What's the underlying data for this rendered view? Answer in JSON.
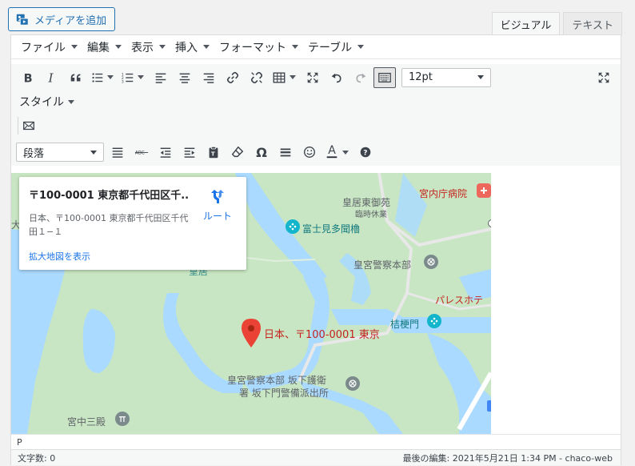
{
  "top": {
    "media_button": "メディアを追加",
    "tabs": [
      {
        "label": "ビジュアル",
        "active": true
      },
      {
        "label": "テキスト",
        "active": false
      }
    ]
  },
  "menubar": [
    "ファイル",
    "編集",
    "表示",
    "挿入",
    "フォーマット",
    "テーブル"
  ],
  "toolbar": {
    "font_size": "12pt",
    "style_label": "スタイル",
    "format_select": "段落",
    "text_color_letter": "A",
    "omega": "Ω"
  },
  "map": {
    "info": {
      "title": "〒100-0001 東京都千代田区千...",
      "address": "日本、〒100-0001 東京都千代田区千代田１−１",
      "route_label": "ルート",
      "larger_map_link": "拡大地図を表示"
    },
    "labels": {
      "koukyo_higashi": "皇居東御苑",
      "rinji_kyugyo": "臨時休業",
      "kunaicho_hospital": "宮内庁病院",
      "fujimi_yagura": "富士見多聞櫓",
      "police_hq": "皇宮警察本部",
      "palace_hotel": "パレスホテ",
      "kikyomon": "桔梗門",
      "marker_label": "日本、〒100-0001 東京",
      "police_sakashita_1": "皇宮警察本部 坂下護衛",
      "police_sakashita_2": "署 坂下門警備派出所",
      "kyuchu_sanden": "宮中三殿",
      "koukyo": "皇居",
      "edge_char": "大"
    }
  },
  "path": "P",
  "status": {
    "word_count": "文字数: 0",
    "last_edit": "最後の編集: 2021年5月21日 1:34 PM - chaco-web"
  },
  "colors": {
    "accent": "#2271b1",
    "map_green": "#c8e6c3",
    "map_water": "#aadaff",
    "marker": "#ea4335"
  }
}
